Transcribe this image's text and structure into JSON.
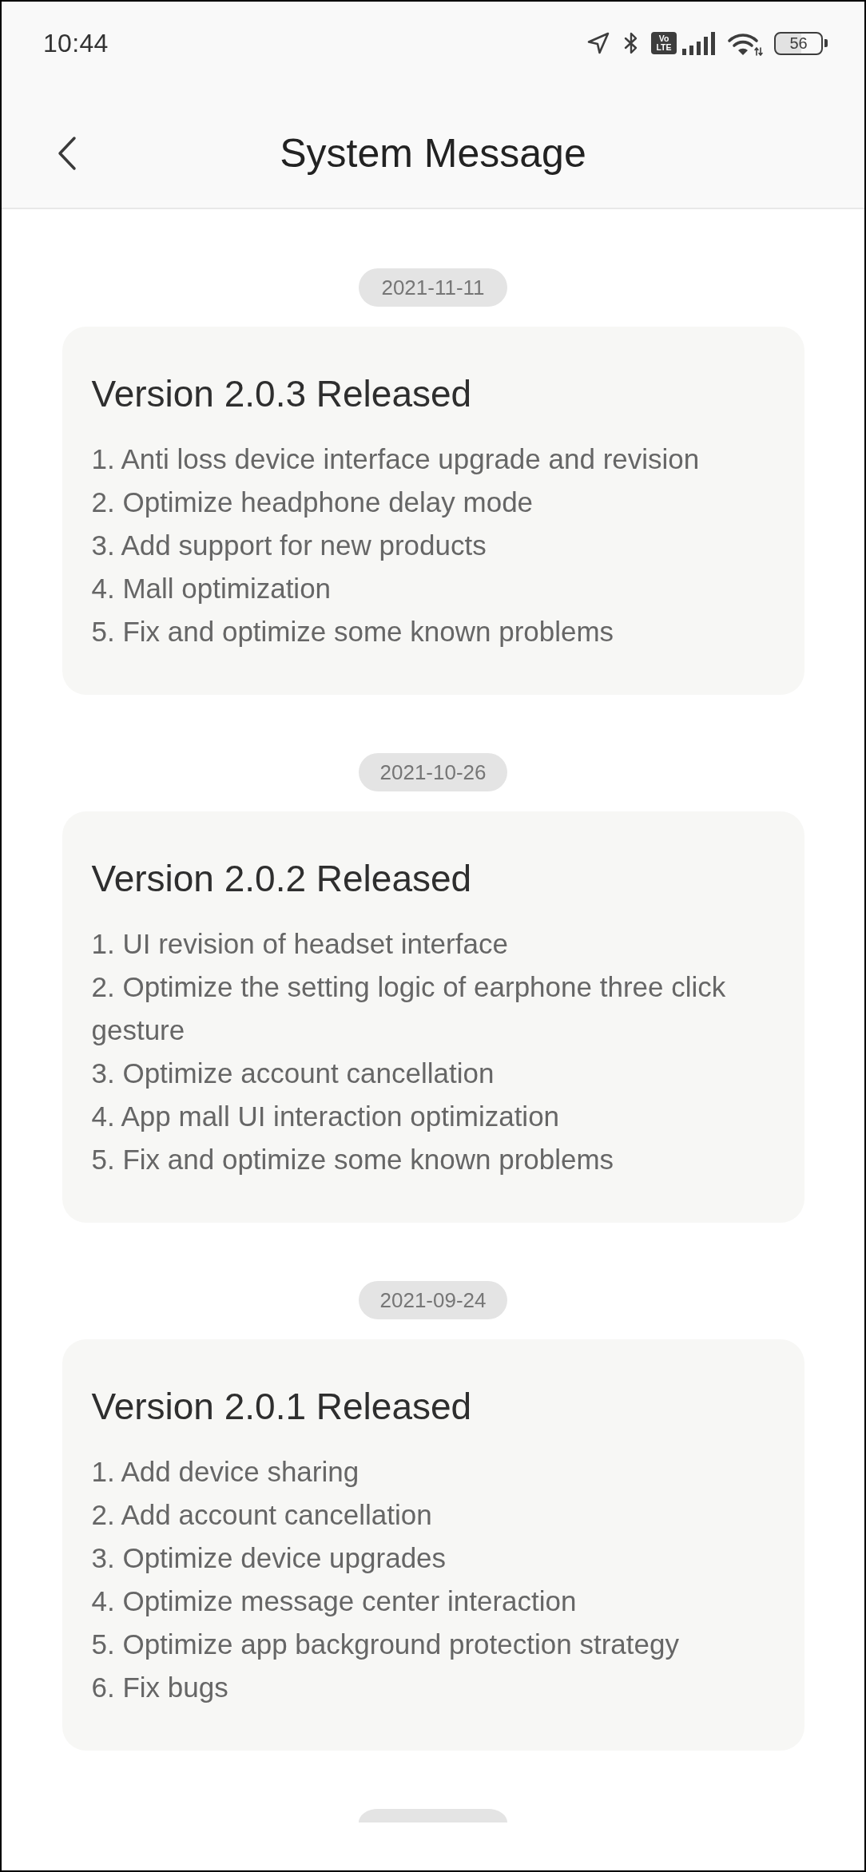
{
  "status_bar": {
    "time": "10:44",
    "volte": [
      "Vo",
      "LTE"
    ],
    "battery": "56"
  },
  "header": {
    "title": "System Message"
  },
  "messages": [
    {
      "date": "2021-11-11",
      "title": "Version 2.0.3 Released",
      "items": [
        "1. Anti loss device interface upgrade and revision",
        "2. Optimize headphone delay mode",
        "3. Add support for new products",
        "4. Mall optimization",
        "5. Fix and optimize some known problems"
      ]
    },
    {
      "date": "2021-10-26",
      "title": "Version 2.0.2 Released",
      "items": [
        "1. UI revision of headset interface",
        "2. Optimize the setting logic of earphone three click gesture",
        "3. Optimize account cancellation",
        "4. App mall UI interaction optimization",
        "5. Fix and optimize some known problems"
      ]
    },
    {
      "date": "2021-09-24",
      "title": "Version 2.0.1 Released",
      "items": [
        "1. Add device sharing",
        "2. Add account cancellation",
        "3. Optimize device upgrades",
        "4. Optimize message center interaction",
        "5. Optimize app background protection strategy",
        "6. Fix bugs"
      ]
    }
  ],
  "more_below": true
}
